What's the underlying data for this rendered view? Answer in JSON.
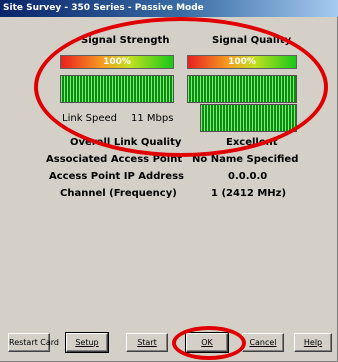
{
  "window": {
    "title": "Site Survey - 350 Series - Passive Mode"
  },
  "signal": {
    "strength_header": "Signal Strength",
    "quality_header": "Signal Quality",
    "strength_percent": "100%",
    "quality_percent": "100%",
    "strength_level": 1.0,
    "quality_level": 1.0
  },
  "link": {
    "speed_label": "Link Speed",
    "speed_value": "11 Mbps"
  },
  "info": {
    "rows": [
      {
        "label": "Overall Link Quality",
        "value": "Excellent"
      },
      {
        "label": "Associated Access Point",
        "value": "No Name Specified"
      },
      {
        "label": "Access Point IP Address",
        "value": "0.0.0.0"
      },
      {
        "label": "Channel (Frequency)",
        "value": "1  (2412 MHz)"
      }
    ]
  },
  "buttons": {
    "restart": "Restart Card",
    "setup": "Setup",
    "start": "Start",
    "ok": "OK",
    "cancel": "Cancel",
    "help": "Help"
  },
  "colors": {
    "annotation": "#e00000",
    "meter_green": "#10a010",
    "titlebar": "#0a246a"
  }
}
